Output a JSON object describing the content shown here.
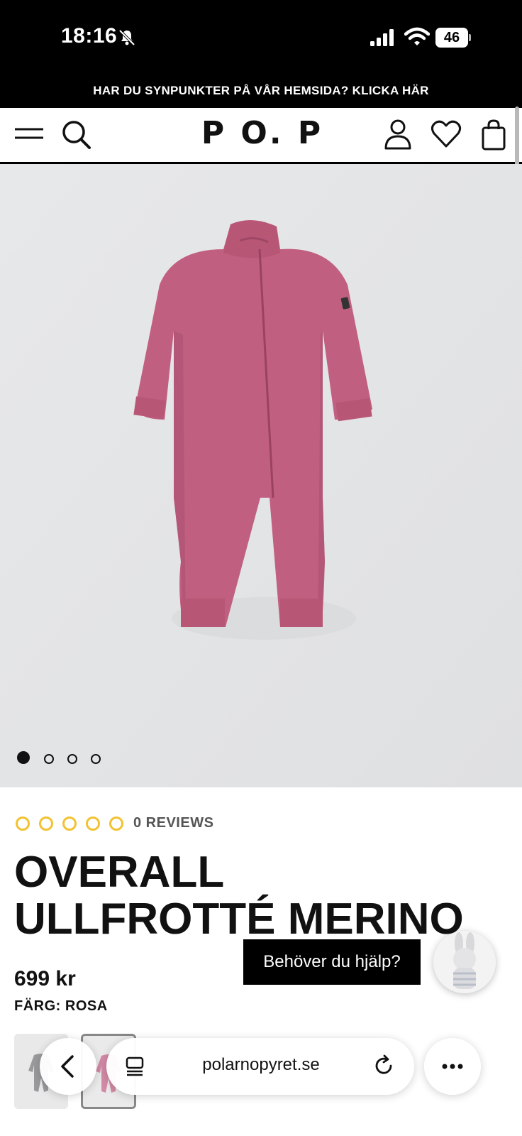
{
  "status_bar": {
    "time": "18:16",
    "battery": "46",
    "icons": [
      "bell-slash-icon",
      "signal-icon",
      "wifi-icon",
      "battery-icon"
    ]
  },
  "promo_banner": {
    "text": "HAR DU SYNPUNKTER PÅ VÅR HEMSIDA? KLICKA HÄR"
  },
  "header": {
    "logo": "P O. P",
    "icons": [
      "menu-icon",
      "search-icon",
      "user-icon",
      "heart-icon",
      "bag-icon"
    ]
  },
  "gallery": {
    "image": "pink merino wool baby overall",
    "slides_total": 4,
    "active_slide": 1
  },
  "product": {
    "rating_value": 0,
    "rating_max": 5,
    "reviews_label": "0 REVIEWS",
    "title": "OVERALL ULLFROTTÉ MERINO",
    "price": "699 kr",
    "color_label": "FÄRG: ROSA"
  },
  "help": {
    "label": "Behöver du hjälp?"
  },
  "browser": {
    "url": "polarnopyret.se",
    "icons": [
      "back-icon",
      "tabs-icon",
      "reload-icon",
      "more-icon"
    ]
  },
  "colors": {
    "accent_star": "#f2c230",
    "product_pink": "#c15f80",
    "image_bg": "#e4e5e7"
  }
}
